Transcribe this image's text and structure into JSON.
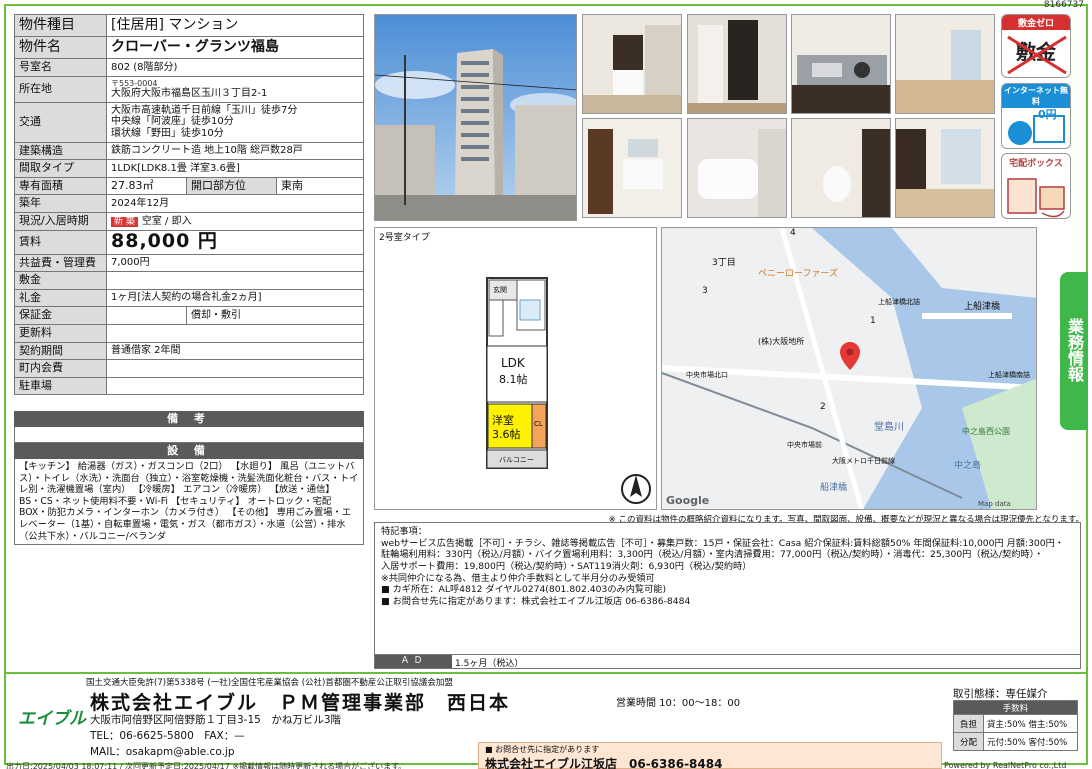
{
  "doc_id": "8166737",
  "property": {
    "type_label": "物件種目",
    "type_value": "[住居用] マンション",
    "name_label": "物件名",
    "name_value": "クローバー・グランツ福島",
    "room_label": "号室名",
    "room_value": "802 (8階部分)",
    "addr_label": "所在地",
    "postal": "〒553-0004",
    "addr_value": "大阪府大阪市福島区玉川３丁目2-1",
    "traffic_label": "交通",
    "traffic": [
      "大阪市高速軌道千日前線「玉川」徒歩7分",
      "中央線「阿波座」徒歩10分",
      "環状線「野田」徒歩10分"
    ],
    "structure_label": "建築構造",
    "structure_value": "鉄筋コンクリート造 地上10階 総戸数28戸",
    "layout_label": "間取タイプ",
    "layout_value": "1LDK[LDK8.1畳 洋室3.6畳]",
    "area_label": "専有面積",
    "area_value": "27.83㎡",
    "opening_label": "開口部方位",
    "opening_value": "東南",
    "built_label": "築年",
    "built_value": "2024年12月",
    "status_label": "現況/入居時期",
    "status_badge": "新 築",
    "status_value": "空室 / 即入",
    "rent_label": "賃料",
    "rent_value": "88,000 円",
    "common_label": "共益費・管理費",
    "common_value": "7,000円",
    "deposit_label": "敷金",
    "deposit_value": "",
    "key_label": "礼金",
    "key_value": "1ヶ月[法人契約の場合礼金2ヵ月]",
    "guarantee_label": "保証金",
    "guarantee_value": "",
    "guarantee_sub_label": "償却・敷引",
    "guarantee_sub_value": "",
    "renew_label": "更新料",
    "renew_value": "",
    "contract_label": "契約期間",
    "contract_value": "普通借家 2年間",
    "town_label": "町内会費",
    "town_value": "",
    "parking_label": "駐車場",
    "parking_value": ""
  },
  "bikou_title": "備 考",
  "setsubi_title": "設 備",
  "setsubi_text": "【キッチン】 給湯器（ガス）・ガスコンロ（2口） 【水廻り】 風呂（ユニットバス）・トイレ（水洗）・洗面台（独立）・浴室乾燥機・洗髪洗面化粧台・バス・トイレ別・洗濯機置場（室内） 【冷暖房】 エアコン（冷暖房） 【放送・通信】 BS・CS・ネット使用料不要・Wi-Fi 【セキュリティ】 オートロック・宅配BOX・防犯カメラ・インターホン（カメラ付き） 【その他】 専用ごみ置場・エレベーター（1基）・自転車置場・電気・ガス（都市ガス）・水道（公営）・排水（公共下水）・バルコニー/ベランダ",
  "icons": {
    "shikikin_zero": "敷金ゼロ",
    "shikikin_strike": "敷金",
    "internet": "インターネット無料",
    "internet_price": "0円",
    "delivery": "宅配ボックス"
  },
  "side_tab": "業務情報",
  "floorplan": {
    "title": "2号室タイプ",
    "entrance": "玄関",
    "ldk": "LDK",
    "ldk_size": "8.1帖",
    "room": "洋室",
    "room_size": "3.6帖",
    "closet": "CL",
    "balcony": "バルコニー"
  },
  "map": {
    "labels": [
      "3丁目",
      "ペニーローファーズ",
      "上船津橋北詰",
      "上船津橋",
      "(株)大阪地所",
      "中央市場北口",
      "上船津橋南詰",
      "中央市場前",
      "大阪メトロ千日前線",
      "堂島川",
      "中之島西公園",
      "中之島",
      "船津橋",
      "3",
      "4",
      "1",
      "2"
    ],
    "google": "Google",
    "copyright": "Map data ©2025"
  },
  "note": "※ この資料は物件の概略紹介資料になります。写真、間取図面、設備、概要などが現況と異なる場合は現況優先となります。",
  "tokki_title": "特記事項：",
  "tokki_lines": [
    "webサービス広告掲載［不可］・チラシ、雑誌等掲載広告［不可］・募集戸数：15戸・保証会社：Casa 紹介保証料:賃料総額50% 年間保証料:10,000円 月額:300円・",
    "駐輪場利用料：330円（税込/月額）・バイク置場利用料：3,300円（税込/月額）・室内清掃費用：77,000円（税込/契約時）・消毒代：25,300円（税込/契約時）・",
    "入居サポート費用：19,800円（税込/契約時）・SAT119消火剤：6,930円（税込/契約時）",
    "※共同仲介になる為、借主より仲介手数料として半月分のみ受領可",
    "■ カギ所在：AL呼4812 ダイヤル0274(801.802.403のみ内覧可能)",
    "■ お問合せ先に指定があります：株式会社エイブル江坂店 06-6386-8484"
  ],
  "ad_label": "ＡＤ",
  "ad_value": "1.5ヶ月（税込）",
  "footer": {
    "license": "国土交通大臣免許(7)第5338号 (一社)全国住宅産業協会 (公社)首都圏不動産公正取引協議会加盟",
    "company": "株式会社エイブル　ＰＭ管理事業部　西日本",
    "logo": "エイブル",
    "address": "大阪市阿倍野区阿倍野筋１丁目3-15　かね万ビル3階",
    "tel": "TEL：06-6625-5800　FAX：—",
    "mail": "MAIL：osakapm@able.co.jp",
    "hours": "営業時間 10：00～18：00",
    "contact_note": "■ お問合せ先に指定があります",
    "contact_main": "株式会社エイブル江坂店　06-6386-8484",
    "trade": "取引態様：専任媒介",
    "fee_head": "手数料",
    "fee_rows": [
      {
        "label": "負担",
        "value": "貸主:50% 借主:50%"
      },
      {
        "label": "分配",
        "value": "元付:50% 客付:50%"
      }
    ],
    "bottom_left": "出力日:2025/04/03 18:07:11 / 次回更新予定日:2025/04/17 ※掲載情報は随時更新される場合がございます。",
    "bottom_right": "Powered by RealNetPro co.,Ltd"
  }
}
